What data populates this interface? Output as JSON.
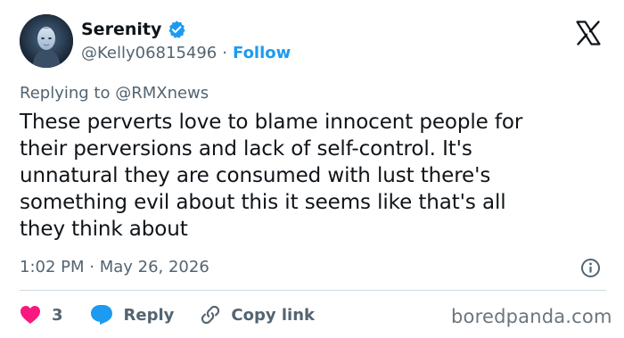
{
  "author": {
    "display_name": "Serenity",
    "handle": "@Kelly06815496",
    "separator": "·",
    "follow_label": "Follow",
    "verified_icon": "verified-badge-icon",
    "verified_color": "#1d9bf0"
  },
  "reply_context": {
    "text": "Replying to @RMXnews"
  },
  "tweet": {
    "text": "These perverts love to blame innocent people for\ntheir perversions and lack of self-control. It's\nunnatural they are consumed with lust there's\nsomething evil about this it seems like that's all\nthey think about",
    "timestamp": "1:02 PM · May 26, 2026"
  },
  "actions": {
    "like_count": "3",
    "reply_label": "Reply",
    "copy_link_label": "Copy link"
  },
  "colors": {
    "accent": "#1d9bf0",
    "like": "#f91880",
    "secondary_text": "#536471",
    "primary_text": "#0f1419"
  },
  "watermark": {
    "text": "boredpanda.com"
  }
}
